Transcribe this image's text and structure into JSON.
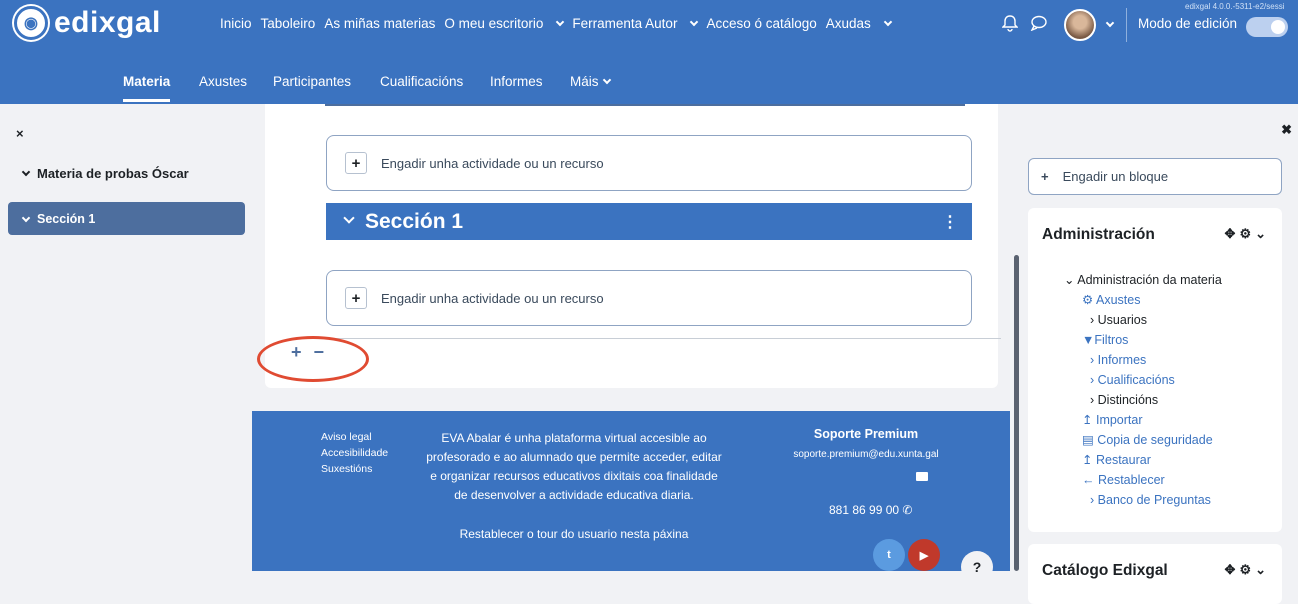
{
  "navbar": {
    "logo_text": "edixgal",
    "items": [
      "Inicio",
      "Taboleiro",
      "As miñas materias",
      "O meu escritorio",
      "Ferramenta Autor",
      "Acceso ó catálogo",
      "Axudas"
    ],
    "edit_mode_label": "Modo de edición",
    "version": "edixgal 4.0.0.-5311-e2/sessi"
  },
  "secondary_nav": {
    "items": [
      "Materia",
      "Axustes",
      "Participantes",
      "Cualificacións",
      "Informes",
      "Máis"
    ]
  },
  "left_drawer": {
    "close_icon": "×",
    "course_name": "Materia de probas Óscar",
    "section_name": "Sección 1"
  },
  "main": {
    "add_activity_label": "Engadir unha actividade ou un recurso",
    "section_title": "Sección 1",
    "add_section_symbol": "+",
    "remove_section_symbol": "−"
  },
  "footer": {
    "links": [
      "Aviso legal",
      "Accesibilidade",
      "Suxestións"
    ],
    "description": "EVA Abalar é unha plataforma virtual accesible ao profesorado e ao alumnado que permite acceder, editar e organizar recursos educativos dixitais coa finalidade de desenvolver a actividade educativa diaria.",
    "tour_link": "Restablecer o tour do usuario nesta páxina",
    "support_title": "Soporte Premium",
    "support_email": "soporte.premium@edu.xunta.gal",
    "support_phone": "881 86 99 00",
    "help_label": "?"
  },
  "right_drawer": {
    "add_block_label": "Engadir un bloque",
    "admin_title": "Administración",
    "admin_tree": {
      "root": "Administración da materia",
      "items": [
        {
          "label": "Axustes",
          "icon": "gear-icon"
        },
        {
          "label": "Usuarios",
          "icon": "chevron-right-icon"
        },
        {
          "label": "Filtros",
          "icon": "filter-icon"
        },
        {
          "label": "Informes",
          "icon": "chevron-right-icon"
        },
        {
          "label": "Cualificacións",
          "icon": "chevron-right-icon"
        },
        {
          "label": "Distincións",
          "icon": "chevron-right-icon"
        },
        {
          "label": "Importar",
          "icon": "upload-icon"
        },
        {
          "label": "Copia de seguridade",
          "icon": "file-icon"
        },
        {
          "label": "Restaurar",
          "icon": "upload-icon"
        },
        {
          "label": "Restablecer",
          "icon": "arrow-left-icon"
        },
        {
          "label": "Banco de Preguntas",
          "icon": "chevron-right-icon"
        }
      ]
    },
    "catalog_title": "Catálogo Edixgal"
  },
  "colors": {
    "brand": "#3b73c0",
    "section_active": "#4d6e9e",
    "annotation": "#e04b32"
  }
}
